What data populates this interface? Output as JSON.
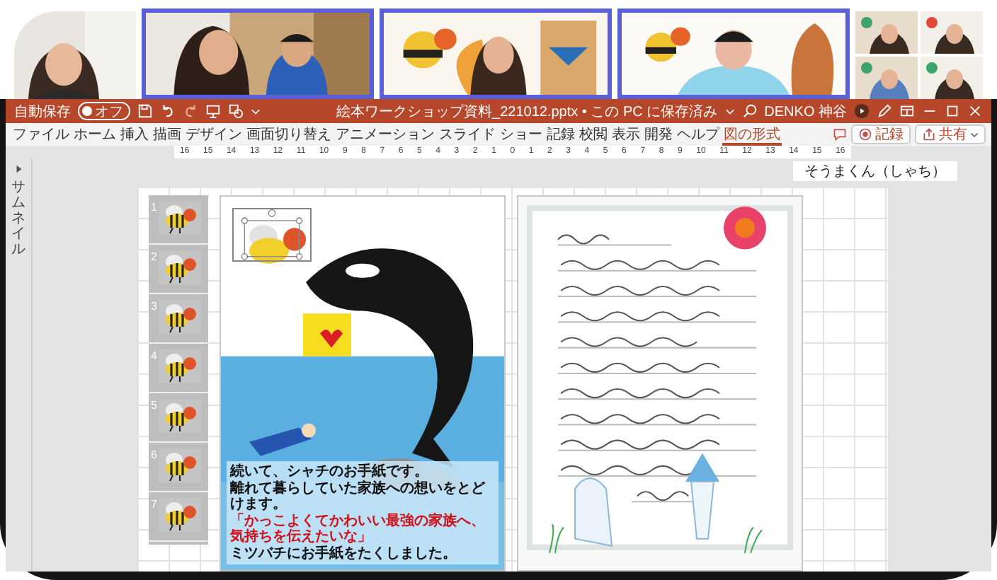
{
  "title_bar": {
    "autosave_label": "自動保存",
    "autosave": {
      "label": "オフ",
      "on": false
    },
    "file_title": "絵本ワークショップ資料_221012.pptx • この PC に保存済み",
    "user_name": "DENKO 神谷"
  },
  "ribbon_tabs": [
    {
      "label": "ファイル",
      "selected": false
    },
    {
      "label": "ホーム",
      "selected": false
    },
    {
      "label": "挿入",
      "selected": false
    },
    {
      "label": "描画",
      "selected": false
    },
    {
      "label": "デザイン",
      "selected": false
    },
    {
      "label": "画面切り替え",
      "selected": false
    },
    {
      "label": "アニメーション",
      "selected": false
    },
    {
      "label": "スライド ショー",
      "selected": false
    },
    {
      "label": "記録",
      "selected": false
    },
    {
      "label": "校閲",
      "selected": false
    },
    {
      "label": "表示",
      "selected": false
    },
    {
      "label": "開発",
      "selected": false
    },
    {
      "label": "ヘルプ",
      "selected": false
    },
    {
      "label": "図の形式",
      "selected": true
    }
  ],
  "record_button": "記録",
  "share_button": "共有",
  "ruler": [
    "16",
    "15",
    "14",
    "13",
    "12",
    "11",
    "10",
    "9",
    "8",
    "7",
    "6",
    "5",
    "4",
    "3",
    "2",
    "1",
    "0",
    "1",
    "2",
    "3",
    "4",
    "5",
    "6",
    "7",
    "8",
    "9",
    "10",
    "11",
    "12",
    "13",
    "14",
    "15",
    "16"
  ],
  "thumbnail_pane_label": "サムネイル",
  "note_label": "そうまくん（しゃち）",
  "slide": {
    "pages": [
      "1",
      "2",
      "3",
      "4",
      "5",
      "6",
      "7"
    ],
    "caption": [
      {
        "text": "続いて、シャチのお手紙です。",
        "kind": "plain"
      },
      {
        "text": "離れて暮らしていた家族への想いをとどけます。",
        "kind": "plain"
      },
      {
        "text": "「かっこよくてかわいい最強の家族へ、気持ちを伝えたいな」",
        "kind": "quote"
      },
      {
        "text": "ミツバチにお手紙をたくしました。",
        "kind": "plain"
      }
    ]
  }
}
